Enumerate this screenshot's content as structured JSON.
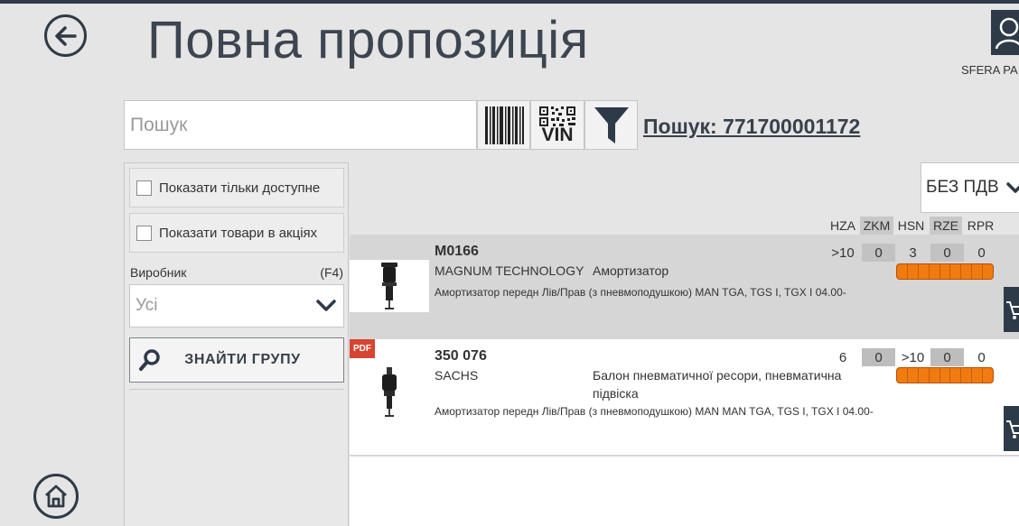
{
  "header": {
    "title": "Повна пропозиція",
    "back_icon": "arrow-left-circle-icon",
    "user_icon": "user-icon",
    "user_name": "SFERA PA"
  },
  "search": {
    "placeholder": "Пошук",
    "value": "",
    "barcode_icon": "barcode-icon",
    "qr_vin_label": "VIN",
    "filter_icon": "funnel-icon",
    "query_text": "Пошук: 771700001172"
  },
  "filters": {
    "only_available": {
      "label": "Показати тільки доступне",
      "checked": false
    },
    "promotions": {
      "label": "Показати товари в акціях",
      "checked": false
    },
    "manufacturer_label": "Виробник",
    "manufacturer_shortcut": "(F4)",
    "manufacturer_value": "Усі",
    "find_group_label": "ЗНАЙТИ ГРУПУ"
  },
  "vat_select": {
    "label": "БЕЗ ПДВ"
  },
  "warehouses": [
    "HZA",
    "ZKM",
    "HSN",
    "RZE",
    "RPR"
  ],
  "products": [
    {
      "code": "M0166",
      "brand": "MAGNUM TECHNOLOGY",
      "type": "Амортизатор",
      "description": "Амортизатор передн Лів/Прав (з пневмоподушкою) MAN TGA, TGS I, TGX I 04.00-",
      "stock": [
        ">10",
        "0",
        "3",
        "0",
        "0"
      ],
      "has_pdf": false
    },
    {
      "code": "350 076",
      "brand": "SACHS",
      "type_line1": "Балон пневматичної ресори, пневматична",
      "type_line2": "підвіска",
      "description": "Амортизатор передн Лів/Прав (з пневмоподушкою) MAN MAN TGA, TGS I, TGX I 04.00-",
      "stock": [
        "6",
        "0",
        ">10",
        "0",
        "0"
      ],
      "has_pdf": true,
      "pdf_label": "PDF"
    }
  ],
  "colors": {
    "accent_dark": "#2d3a48",
    "availability_orange": "#f07b10",
    "pdf_red": "#d64532"
  }
}
